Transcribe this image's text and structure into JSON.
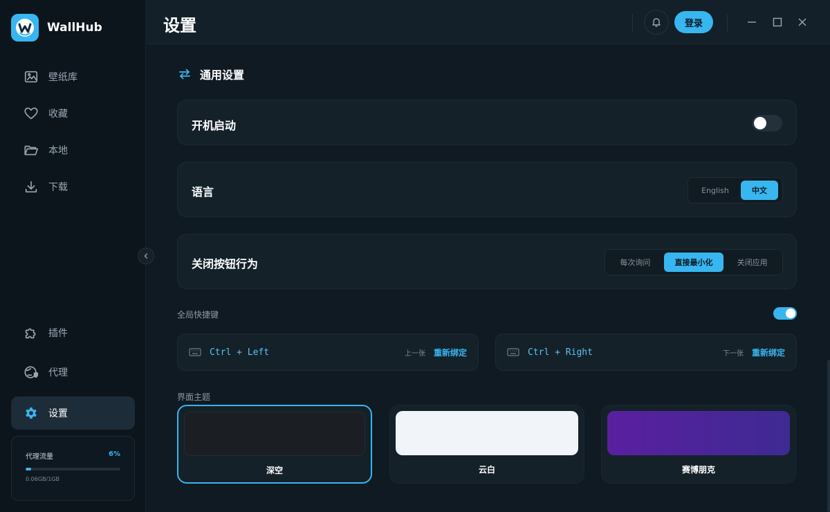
{
  "app": {
    "name": "WallHub"
  },
  "sidebar": {
    "items": [
      {
        "label": "壁纸库",
        "icon": "image-icon"
      },
      {
        "label": "收藏",
        "icon": "heart-icon"
      },
      {
        "label": "本地",
        "icon": "folder-icon"
      },
      {
        "label": "下载",
        "icon": "download-icon"
      }
    ],
    "bottom_items": [
      {
        "label": "插件",
        "icon": "puzzle-icon"
      },
      {
        "label": "代理",
        "icon": "globe-shield-icon"
      },
      {
        "label": "设置",
        "icon": "gear-icon",
        "active": true
      }
    ],
    "traffic": {
      "label": "代理流量",
      "percent_text": "6%",
      "percent": 6,
      "usage": "0.06GB/1GB"
    }
  },
  "header": {
    "title": "设置",
    "login_label": "登录"
  },
  "general": {
    "title": "通用设置",
    "autostart": {
      "label": "开机启动",
      "enabled": false
    },
    "language": {
      "label": "语言",
      "options": [
        "English",
        "中文"
      ],
      "selected": "中文"
    },
    "close_behavior": {
      "label": "关闭按钮行为",
      "options": [
        "每次询问",
        "直接最小化",
        "关闭应用"
      ],
      "selected": "直接最小化"
    }
  },
  "hotkeys": {
    "label": "全局快捷键",
    "enabled": true,
    "items": [
      {
        "combo": "Ctrl + Left",
        "action": "上一张",
        "rebind": "重新绑定"
      },
      {
        "combo": "Ctrl + Right",
        "action": "下一张",
        "rebind": "重新绑定"
      }
    ]
  },
  "theme": {
    "label": "界面主题",
    "options": [
      {
        "name": "深空",
        "color": "#1b1f24",
        "selected": true
      },
      {
        "name": "云白",
        "color": "#f1f4f9"
      },
      {
        "name": "赛博朋克",
        "color": "#5a1fa0"
      }
    ]
  },
  "colors": {
    "accent": "#38b6f0",
    "background": "#0f1a22",
    "sidebar": "#0c151c",
    "card": "#142129"
  }
}
